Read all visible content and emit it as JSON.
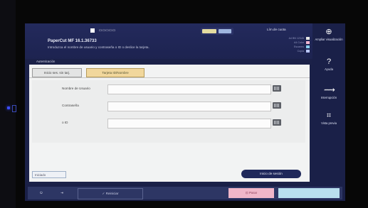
{
  "header": {
    "product": "PaperCut MF 16.1.36733",
    "instructions": "Introduzca el nombre de usuario y contraseña o ID o deslice la tarjeta.",
    "limit_label": "Lím.de cuota",
    "limit_rows": [
      {
        "text": "A4 BN 12345",
        "color": "#e8e8e8"
      },
      {
        "text": "A4 Color",
        "color": "#f2b6d0"
      },
      {
        "text": "Escaneo",
        "color": "#8ad0f0"
      },
      {
        "text": "Copia",
        "color": "#b9c6ff"
      }
    ]
  },
  "sidebar": {
    "items": [
      {
        "icon": "zoom-icon",
        "glyph": "⊕",
        "label": "Ampliar visualización"
      },
      {
        "icon": "help-icon",
        "glyph": "?",
        "label": "Ayuda"
      },
      {
        "icon": "interrupt-icon",
        "glyph": "⟿",
        "label": "Interrupción"
      },
      {
        "icon": "preview-icon",
        "glyph": "⌗",
        "label": "Vista previa"
      }
    ]
  },
  "panel": {
    "title": "Autenticación",
    "tabs": [
      {
        "label": "Inicio ses. sin tarj.",
        "active": false
      },
      {
        "label": "Tarjeta ID/Nombre",
        "active": true
      }
    ],
    "fields": [
      {
        "label": "Nombre de Usuario",
        "value": ""
      },
      {
        "label": "Contraseña",
        "value": ""
      },
      {
        "label": "o ID",
        "value": ""
      }
    ],
    "status": "Iniciado",
    "login_button": "Inicio de sesión"
  },
  "bottom": {
    "power": "⏻",
    "logout": "⇥",
    "release": "✓  Reiniciar",
    "print": "⊡  Parar",
    "disabled": ""
  },
  "colors": {
    "screen_bg": "#1b2148",
    "active_tab": "#f1d79c",
    "login_button": "#1f285a",
    "print_button": "#f0b6c9"
  }
}
